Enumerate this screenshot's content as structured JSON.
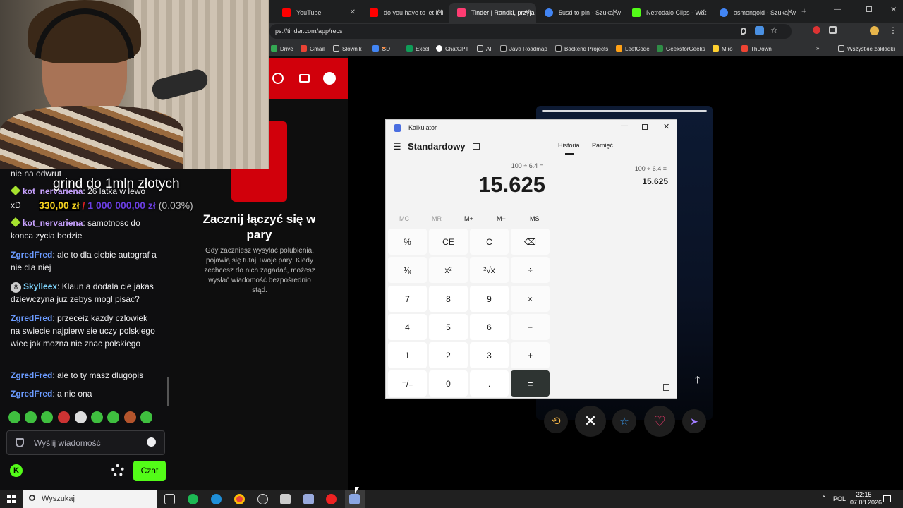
{
  "browser": {
    "tabs": [
      {
        "title": "YouTube",
        "color": "#ff0000"
      },
      {
        "title": "do you have to let it li",
        "color": "#ff0000"
      },
      {
        "title": "Tinder | Randki, przyja",
        "color": "#fe3c72"
      },
      {
        "title": "5usd to pln - Szukaj w",
        "color": "#4285f4"
      },
      {
        "title": "Netrodalo Clips - Wat",
        "color": "#53fc18"
      },
      {
        "title": "asmongold - Szukaj w",
        "color": "#4285f4"
      }
    ],
    "url": "ps://tinder.com/app/recs",
    "bookmarks": [
      "Drive",
      "Gmail",
      "Słownik",
      "GD",
      "Excel",
      "ChatGPT",
      "AI",
      "Java Roadmap",
      "Backend Projects",
      "LeetCode",
      "GeeksforGeeks",
      "Miro",
      "ThDown"
    ],
    "all_bookmarks": "Wszystkie zakładki"
  },
  "overlay": {
    "goal_title": "grind do 1mln złotych",
    "xd": "xD",
    "current": "330,00 zł",
    "sep": "/",
    "goal": "1 000 000,00 zł",
    "pct": "(0.03%)"
  },
  "chat": {
    "partial": "nie na odwrut",
    "messages": [
      {
        "user": "kot_nervariena",
        "color": "#c8a2ff",
        "text": "26 latka w lewo",
        "badge": "diamond"
      },
      {
        "user": "kot_nervariena",
        "color": "#c8a2ff",
        "text": "samotnosc do konca zycia bedzie",
        "badge": "diamond"
      },
      {
        "user": "ZgredFred",
        "color": "#6b9bff",
        "text": "ale to dla ciebie autograf a nie dla niej",
        "badge": ""
      },
      {
        "user": "Skylleex",
        "color": "#7fd6ff",
        "text": "Klaun a dodala cie jakas dziewczyna juz zebys mogl pisac?",
        "badge": "8"
      },
      {
        "user": "ZgredFred",
        "color": "#6b9bff",
        "text": "przeceiz kazdy czlowiek na swiecie najpierw sie uczy polskiego wiec jak mozna nie znac polskiego",
        "badge": ""
      },
      {
        "user": "ZgredFred",
        "color": "#6b9bff",
        "text": "ale to ty masz dlugopis",
        "badge": ""
      },
      {
        "user": "ZgredFred",
        "color": "#6b9bff",
        "text": "a nie ona",
        "badge": ""
      }
    ],
    "input_placeholder": "Wyślij wiadomość",
    "send_label": "Czat"
  },
  "tinder": {
    "heading": "Zacznij łączyć się w pary",
    "body": "Gdy zaczniesz wysyłać polubienia, pojawią się tutaj Twoje pary. Kiedy zechcesz do nich zagadać, możesz wysłać wiadomość bezpośrednio stąd."
  },
  "calculator": {
    "title": "Kalkulator",
    "mode": "Standardowy",
    "expression": "100 ÷ 6.4 =",
    "result": "15.625",
    "history_tab": "Historia",
    "memory_tab": "Pamięć",
    "history_expr": "100  ÷  6.4 =",
    "history_result": "15.625",
    "memory": [
      "MC",
      "MR",
      "M+",
      "M−",
      "MS"
    ],
    "keys": [
      "%",
      "CE",
      "C",
      "⌫",
      "¹⁄ₓ",
      "x²",
      "²√x",
      "÷",
      "7",
      "8",
      "9",
      "×",
      "4",
      "5",
      "6",
      "−",
      "1",
      "2",
      "3",
      "+",
      "⁺/₋",
      "0",
      ".",
      "="
    ]
  },
  "taskbar": {
    "search": "Wyszukaj",
    "lang": "POL",
    "time": "22:15",
    "date": "07.08.2026"
  }
}
